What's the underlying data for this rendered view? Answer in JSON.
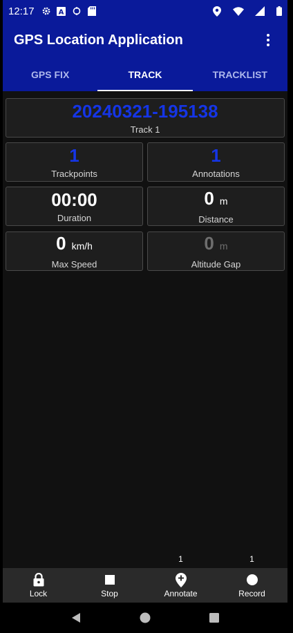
{
  "status_bar": {
    "time": "12:17",
    "icons_left": [
      "settings-icon",
      "a-icon",
      "sync-icon",
      "sd-card-icon"
    ],
    "icons_right": [
      "location-pin-icon",
      "wifi-icon",
      "signal-icon",
      "battery-icon"
    ]
  },
  "app_bar": {
    "title": "GPS Location Application",
    "menu_icon": "more-vert-icon"
  },
  "tabs": [
    {
      "label": "GPS FIX",
      "active": false
    },
    {
      "label": "TRACK",
      "active": true
    },
    {
      "label": "TRACKLIST",
      "active": false
    }
  ],
  "track": {
    "id": "20240321-195138",
    "name": "Track 1"
  },
  "stats": {
    "trackpoints": {
      "value": "1",
      "label": "Trackpoints"
    },
    "annotations": {
      "value": "1",
      "label": "Annotations"
    },
    "duration": {
      "value": "00:00",
      "label": "Duration"
    },
    "distance": {
      "value": "0",
      "unit": "m",
      "label": "Distance"
    },
    "max_speed": {
      "value": "0",
      "unit": "km/h",
      "label": "Max Speed"
    },
    "altitude_gap": {
      "value": "0",
      "unit": "m",
      "label": "Altitude Gap"
    }
  },
  "actions": {
    "lock": {
      "label": "Lock",
      "icon": "lock-icon"
    },
    "stop": {
      "label": "Stop",
      "icon": "stop-icon"
    },
    "annotate": {
      "label": "Annotate",
      "icon": "add-location-icon",
      "badge": "1"
    },
    "record": {
      "label": "Record",
      "icon": "record-icon",
      "badge": "1"
    }
  },
  "colors": {
    "primary": "#0a1a9a",
    "accent_blue": "#1535e6",
    "background": "#111111",
    "card": "#1e1e1e"
  }
}
